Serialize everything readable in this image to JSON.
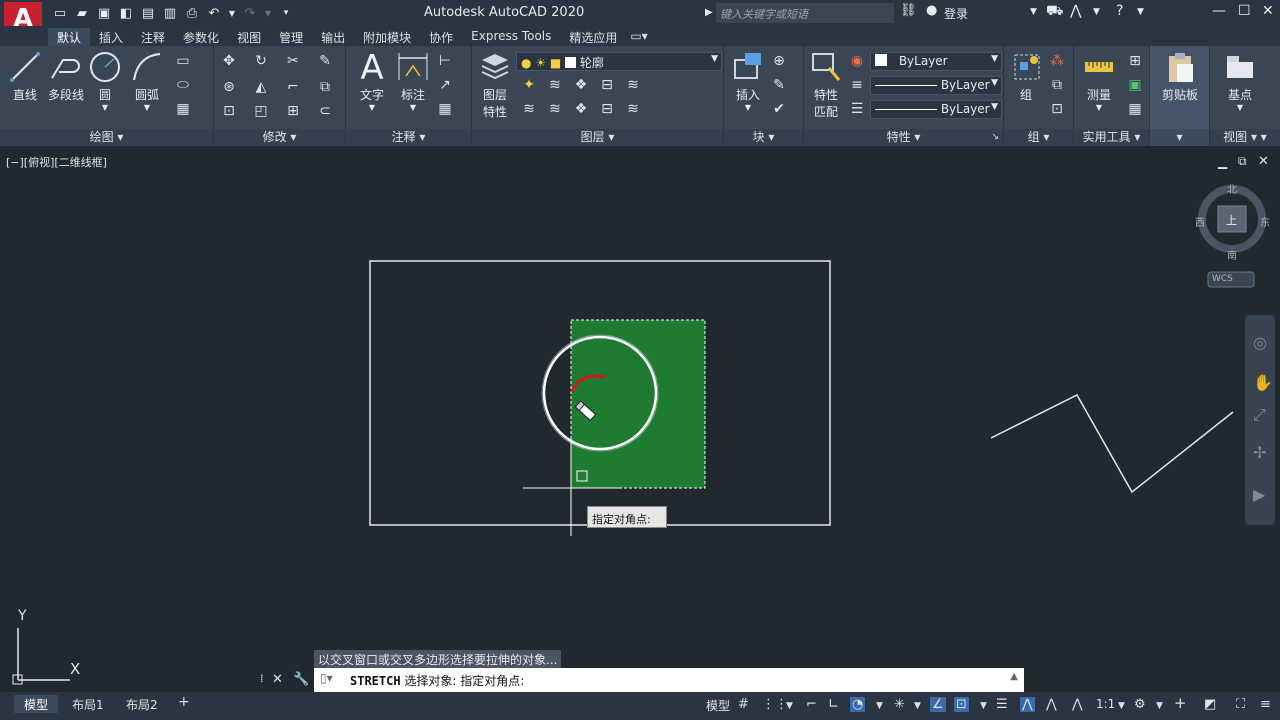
{
  "app": {
    "title": "Autodesk AutoCAD 2020",
    "logo_letter": "A",
    "search_placeholder": "键入关键字或短语",
    "login_label": "登录"
  },
  "ribbon_tabs": [
    "默认",
    "插入",
    "注释",
    "参数化",
    "视图",
    "管理",
    "输出",
    "附加模块",
    "协作",
    "Express Tools",
    "精选应用"
  ],
  "ribbon": {
    "draw": {
      "title": "绘图",
      "line": "直线",
      "polyline": "多段线",
      "circle": "圆",
      "arc": "圆弧"
    },
    "modify": {
      "title": "修改"
    },
    "annotation": {
      "title": "注释",
      "text": "文字",
      "dimension": "标注"
    },
    "layers": {
      "title": "图层",
      "layer_props": "图层\n特性",
      "layer_props_line1": "图层",
      "layer_props_line2": "特性",
      "current_layer": "轮廓"
    },
    "block": {
      "title": "块",
      "insert": "插入"
    },
    "properties": {
      "title": "特性",
      "match_line1": "特性",
      "match_line2": "匹配",
      "color": "ByLayer",
      "linetype": "ByLayer",
      "lineweight": "ByLayer"
    },
    "groups": {
      "title": "组",
      "group": "组"
    },
    "utilities": {
      "title": "实用工具",
      "measure": "测量"
    },
    "clipboard": {
      "title": "",
      "paste": "剪贴板"
    },
    "view": {
      "title": "视图",
      "base": "基点"
    }
  },
  "viewport": {
    "label": "[−][俯视][二维线框]",
    "viewcube": {
      "north": "北",
      "south": "南",
      "east": "东",
      "west": "西",
      "top": "上",
      "wcs": "WCS"
    },
    "ucs": {
      "x": "X",
      "y": "Y"
    }
  },
  "tooltip": {
    "prompt": "指定对角点:"
  },
  "command": {
    "history": "以交叉窗口或交叉多边形选择要拉伸的对象...",
    "name": "STRETCH",
    "text": "选择对象: 指定对角点:"
  },
  "layout_tabs": [
    "模型",
    "布局1",
    "布局2"
  ],
  "status": {
    "model": "模型",
    "scale": "1:1"
  },
  "colors": {
    "accent_green": "#1f7a32",
    "red_arc": "#d01a1a",
    "background": "#212830"
  }
}
